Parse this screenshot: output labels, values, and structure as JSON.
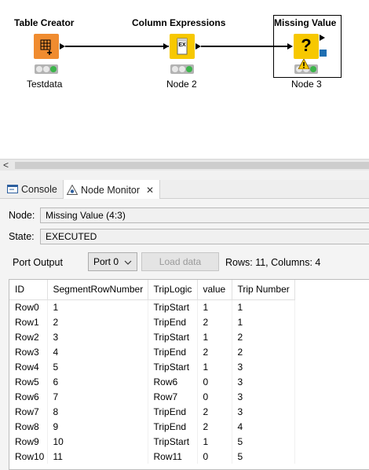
{
  "workflow": {
    "nodes": [
      {
        "title": "Table Creator",
        "label": "Testdata",
        "icon": "table-grid-icon",
        "color": "#f08c30"
      },
      {
        "title": "Column Expressions",
        "label": "Node 2",
        "icon": "expression-icon",
        "color": "#f7c800"
      },
      {
        "title": "Missing Value",
        "label": "Node 3",
        "icon": "question-mark-icon",
        "color": "#f7c800"
      }
    ],
    "node2_icon_text": "EX",
    "node3_icon_text": "?",
    "status_colors": {
      "idle": "#e8e8e8",
      "executed": "#3cb44b",
      "warning": "#f7c800"
    }
  },
  "tabs": [
    {
      "label": "Console",
      "icon": "console-icon"
    },
    {
      "label": "Node Monitor",
      "icon": "node-monitor-icon",
      "close": "✕"
    }
  ],
  "monitor": {
    "node_label": "Node:",
    "node_value": "Missing Value  (4:3)",
    "state_label": "State:",
    "state_value": "EXECUTED",
    "port_output_label": "Port Output",
    "port_select": "Port 0",
    "load_button": "Load data",
    "rows_info": "Rows: 11, Columns: 4"
  },
  "table": {
    "headers": [
      "ID",
      "SegmentRowNumber",
      "TripLogic",
      "value",
      "Trip Number"
    ],
    "rows": [
      [
        "Row0",
        "1",
        "TripStart",
        "1",
        "1"
      ],
      [
        "Row1",
        "2",
        "TripEnd",
        "2",
        "1"
      ],
      [
        "Row2",
        "3",
        "TripStart",
        "1",
        "2"
      ],
      [
        "Row3",
        "4",
        "TripEnd",
        "2",
        "2"
      ],
      [
        "Row4",
        "5",
        "TripStart",
        "1",
        "3"
      ],
      [
        "Row5",
        "6",
        "Row6",
        "0",
        "3"
      ],
      [
        "Row6",
        "7",
        "Row7",
        "0",
        "3"
      ],
      [
        "Row7",
        "8",
        "TripEnd",
        "2",
        "3"
      ],
      [
        "Row8",
        "9",
        "TripEnd",
        "2",
        "4"
      ],
      [
        "Row9",
        "10",
        "TripStart",
        "1",
        "5"
      ],
      [
        "Row10",
        "11",
        "Row11",
        "0",
        "5"
      ]
    ]
  },
  "scroll_left_arrow": "<"
}
